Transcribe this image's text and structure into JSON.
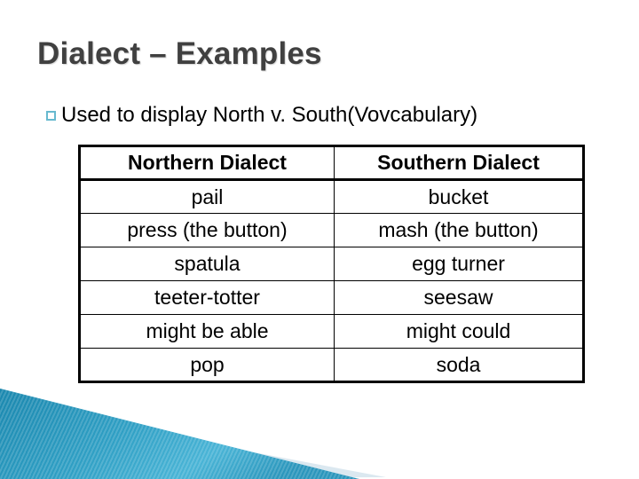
{
  "slide": {
    "title": "Dialect – Examples",
    "bullet": {
      "marker": "hollow-square-bullet",
      "text": "Used to display North v. South(Vovcabulary)"
    }
  },
  "table": {
    "headers": [
      "Northern Dialect",
      "Southern Dialect"
    ],
    "rows": [
      [
        "pail",
        "bucket"
      ],
      [
        "press (the button)",
        "mash (the button)"
      ],
      [
        "spatula",
        "egg turner"
      ],
      [
        "teeter-totter",
        "seesaw"
      ],
      [
        "might be able",
        "might could"
      ],
      [
        "pop",
        "soda"
      ]
    ]
  },
  "theme": {
    "title_color": "#404040",
    "bullet_marker_color": "#67b9cf",
    "accent_blue_dark": "#1a87ae",
    "accent_blue_light": "#49b4d6",
    "accent_black": "#000000",
    "accent_pale_blue": "#dbe8f0",
    "background": "#ffffff"
  }
}
